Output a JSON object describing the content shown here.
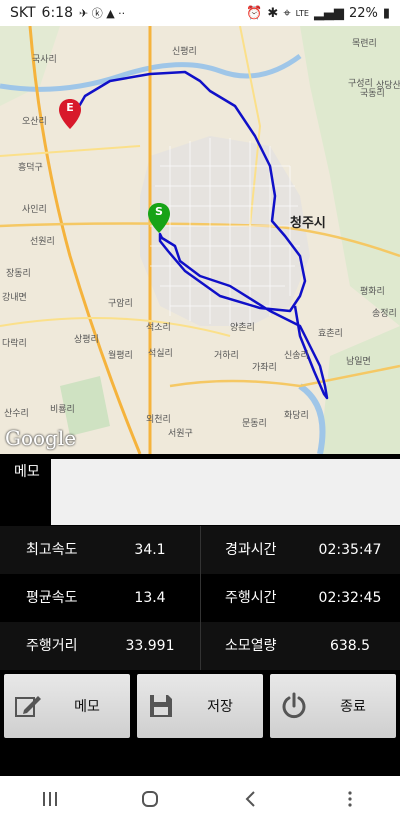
{
  "status_bar": {
    "carrier": "SKT",
    "time": "6:18",
    "battery": "22%",
    "network": "LTE"
  },
  "map": {
    "city_label": "청주시",
    "district_label": "흥덕구",
    "district_label_2": "서원구",
    "provider": "Google",
    "start_marker": "S",
    "end_marker": "E",
    "place_labels": [
      "국사리",
      "신평리",
      "오산리",
      "사인리",
      "선원리",
      "구성리",
      "목련리",
      "상당산",
      "국동리",
      "석소리",
      "구암리",
      "상평리",
      "월평리",
      "석실리",
      "양촌리",
      "거하리",
      "가좌리",
      "남일면",
      "비룡리",
      "외천리",
      "문동리",
      "효촌리",
      "화당리",
      "신송리",
      "산수리",
      "평화리",
      "송정리",
      "장동리",
      "강내면",
      "다락리"
    ]
  },
  "memo": {
    "label": "메모",
    "value": ""
  },
  "stats": {
    "max_speed_label": "최고속도",
    "max_speed": "34.1",
    "elapsed_label": "경과시간",
    "elapsed": "02:35:47",
    "avg_speed_label": "평균속도",
    "avg_speed": "13.4",
    "moving_time_label": "주행시간",
    "moving_time": "02:32:45",
    "distance_label": "주행거리",
    "distance": "33.991",
    "calories_label": "소모열량",
    "calories": "638.5"
  },
  "buttons": {
    "memo": "메모",
    "save": "저장",
    "exit": "종료"
  }
}
